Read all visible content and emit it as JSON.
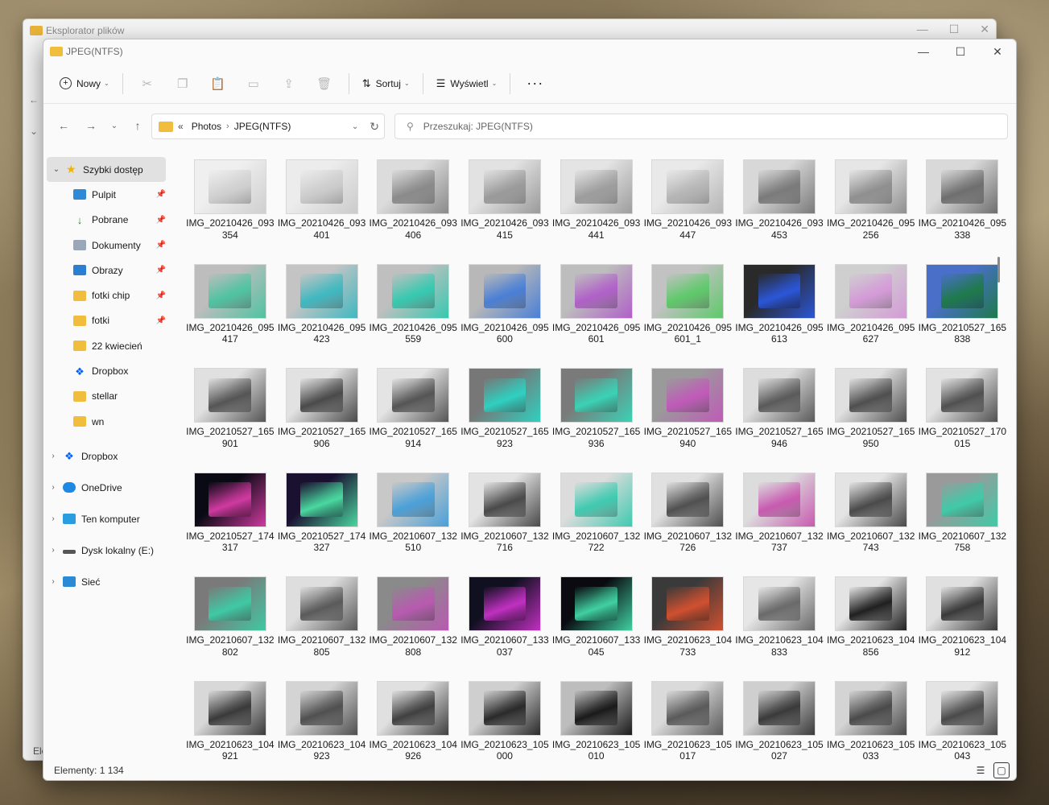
{
  "bg_window": {
    "title": "Eksplorator plików",
    "label": "Ele"
  },
  "window": {
    "title": "JPEG(NTFS)",
    "controls": {
      "minimize": "—",
      "maximize": "☐",
      "close": "✕"
    }
  },
  "toolbar": {
    "new_label": "Nowy",
    "sort_label": "Sortuj",
    "view_label": "Wyświetl",
    "more": "···"
  },
  "address": {
    "prefix": "«",
    "crumbs": [
      "Photos",
      "JPEG(NTFS)"
    ],
    "search_placeholder": "Przeszukaj: JPEG(NTFS)"
  },
  "sidebar": {
    "quick_access": "Szybki dostęp",
    "pinned": [
      {
        "label": "Pulpit",
        "icon": "desktop-icon",
        "pinned": true
      },
      {
        "label": "Pobrane",
        "icon": "download-icon",
        "pinned": true
      },
      {
        "label": "Dokumenty",
        "icon": "documents-icon",
        "pinned": true
      },
      {
        "label": "Obrazy",
        "icon": "pictures-icon",
        "pinned": true
      },
      {
        "label": "fotki chip",
        "icon": "folder-icon",
        "pinned": true
      },
      {
        "label": "fotki",
        "icon": "folder-icon",
        "pinned": true
      },
      {
        "label": "22 kwiecień",
        "icon": "folder-icon",
        "pinned": false
      },
      {
        "label": "Dropbox",
        "icon": "dropbox-icon",
        "pinned": false
      },
      {
        "label": "stellar",
        "icon": "folder-icon",
        "pinned": false
      },
      {
        "label": "wn",
        "icon": "folder-icon",
        "pinned": false
      }
    ],
    "roots": [
      {
        "label": "Dropbox",
        "icon": "dropbox-icon"
      },
      {
        "label": "OneDrive",
        "icon": "onedrive-icon"
      },
      {
        "label": "Ten komputer",
        "icon": "computer-icon"
      },
      {
        "label": "Dysk lokalny (E:)",
        "icon": "drive-icon"
      },
      {
        "label": "Sieć",
        "icon": "network-icon"
      }
    ]
  },
  "files": [
    {
      "name": "IMG_20210426_093354",
      "c1": "#cfcfcf",
      "c2": "#efefef"
    },
    {
      "name": "IMG_20210426_093401",
      "c1": "#cbcbcb",
      "c2": "#ececec"
    },
    {
      "name": "IMG_20210426_093406",
      "c1": "#8a8a8a",
      "c2": "#dcdcdc"
    },
    {
      "name": "IMG_20210426_093415",
      "c1": "#9a9a9a",
      "c2": "#e2e2e2"
    },
    {
      "name": "IMG_20210426_093441",
      "c1": "#9d9d9d",
      "c2": "#e4e4e4"
    },
    {
      "name": "IMG_20210426_093447",
      "c1": "#b5b5b5",
      "c2": "#e9e9e9"
    },
    {
      "name": "IMG_20210426_093453",
      "c1": "#7a7a7a",
      "c2": "#d8d8d8"
    },
    {
      "name": "IMG_20210426_095256",
      "c1": "#8f8f8f",
      "c2": "#e6e6e6"
    },
    {
      "name": "IMG_20210426_095338",
      "c1": "#6e6e6e",
      "c2": "#d9d9d9"
    },
    {
      "name": "IMG_20210426_095417",
      "c1": "#4fc3a1",
      "c2": "#bdbdbd"
    },
    {
      "name": "IMG_20210426_095423",
      "c1": "#3fb8c0",
      "c2": "#c4c4c4"
    },
    {
      "name": "IMG_20210426_095559",
      "c1": "#36c9b0",
      "c2": "#bfbfbf"
    },
    {
      "name": "IMG_20210426_095600",
      "c1": "#4a7fd6",
      "c2": "#b8b8b8"
    },
    {
      "name": "IMG_20210426_095601",
      "c1": "#b060c8",
      "c2": "#bdbdbd"
    },
    {
      "name": "IMG_20210426_095601_1",
      "c1": "#5ec96a",
      "c2": "#c2c2c2"
    },
    {
      "name": "IMG_20210426_095613",
      "c1": "#2b56d8",
      "c2": "#2a2a2a"
    },
    {
      "name": "IMG_20210426_095627",
      "c1": "#d49ad8",
      "c2": "#cfcfcf"
    },
    {
      "name": "IMG_20210527_165838",
      "c1": "#1e7a4a",
      "c2": "#4a6fc9"
    },
    {
      "name": "IMG_20210527_165901",
      "c1": "#555555",
      "c2": "#e0e0e0"
    },
    {
      "name": "IMG_20210527_165906",
      "c1": "#4a4a4a",
      "c2": "#e2e2e2"
    },
    {
      "name": "IMG_20210527_165914",
      "c1": "#555555",
      "c2": "#e4e4e4"
    },
    {
      "name": "IMG_20210527_165923",
      "c1": "#2fd0c0",
      "c2": "#777777"
    },
    {
      "name": "IMG_20210527_165936",
      "c1": "#3ad2b5",
      "c2": "#7a7a7a"
    },
    {
      "name": "IMG_20210527_165940",
      "c1": "#c05ab8",
      "c2": "#9a9a9a"
    },
    {
      "name": "IMG_20210527_165946",
      "c1": "#5a5a5a",
      "c2": "#dddddd"
    },
    {
      "name": "IMG_20210527_165950",
      "c1": "#4f4f4f",
      "c2": "#e0e0e0"
    },
    {
      "name": "IMG_20210527_170015",
      "c1": "#505050",
      "c2": "#e2e2e2"
    },
    {
      "name": "IMG_20210527_174317",
      "c1": "#d03aa0",
      "c2": "#0a0a14"
    },
    {
      "name": "IMG_20210527_174327",
      "c1": "#4ad8a0",
      "c2": "#1a1030"
    },
    {
      "name": "IMG_20210607_132510",
      "c1": "#4aa0d8",
      "c2": "#c8c8c8"
    },
    {
      "name": "IMG_20210607_132716",
      "c1": "#4a4a4a",
      "c2": "#e3e3e3"
    },
    {
      "name": "IMG_20210607_132722",
      "c1": "#3fcab0",
      "c2": "#dcdcdc"
    },
    {
      "name": "IMG_20210607_132726",
      "c1": "#505050",
      "c2": "#e0e0e0"
    },
    {
      "name": "IMG_20210607_132737",
      "c1": "#c85ab0",
      "c2": "#dcdcdc"
    },
    {
      "name": "IMG_20210607_132743",
      "c1": "#4a4a4a",
      "c2": "#e4e4e4"
    },
    {
      "name": "IMG_20210607_132758",
      "c1": "#3fcaa8",
      "c2": "#9a9a9a"
    },
    {
      "name": "IMG_20210607_132802",
      "c1": "#3fc9a4",
      "c2": "#7a7a7a"
    },
    {
      "name": "IMG_20210607_132805",
      "c1": "#5a5a5a",
      "c2": "#dedede"
    },
    {
      "name": "IMG_20210607_132808",
      "c1": "#b85ab0",
      "c2": "#8a8a8a"
    },
    {
      "name": "IMG_20210607_133037",
      "c1": "#c030c0",
      "c2": "#101020"
    },
    {
      "name": "IMG_20210607_133045",
      "c1": "#40d0a0",
      "c2": "#0a0a10"
    },
    {
      "name": "IMG_20210623_104733",
      "c1": "#d05030",
      "c2": "#3a3a3a"
    },
    {
      "name": "IMG_20210623_104833",
      "c1": "#6a6a6a",
      "c2": "#e6e6e6"
    },
    {
      "name": "IMG_20210623_104856",
      "c1": "#202020",
      "c2": "#e4e4e4"
    },
    {
      "name": "IMG_20210623_104912",
      "c1": "#3a3a3a",
      "c2": "#e0e0e0"
    },
    {
      "name": "IMG_20210623_104921",
      "c1": "#3a3a3a",
      "c2": "#d8d8d8"
    },
    {
      "name": "IMG_20210623_104923",
      "c1": "#505050",
      "c2": "#d4d4d4"
    },
    {
      "name": "IMG_20210623_104926",
      "c1": "#404040",
      "c2": "#e0e0e0"
    },
    {
      "name": "IMG_20210623_105000",
      "c1": "#2a2a2a",
      "c2": "#cfcfcf"
    },
    {
      "name": "IMG_20210623_105010",
      "c1": "#1a1a1a",
      "c2": "#bdbdbd"
    },
    {
      "name": "IMG_20210623_105017",
      "c1": "#5a5a5a",
      "c2": "#dadada"
    },
    {
      "name": "IMG_20210623_105027",
      "c1": "#3a3a3a",
      "c2": "#cfcfcf"
    },
    {
      "name": "IMG_20210623_105033",
      "c1": "#4a4a4a",
      "c2": "#d4d4d4"
    },
    {
      "name": "IMG_20210623_105043",
      "c1": "#4a4a4a",
      "c2": "#e4e4e4"
    }
  ],
  "status": {
    "items_label": "Elementy: 1 134"
  }
}
